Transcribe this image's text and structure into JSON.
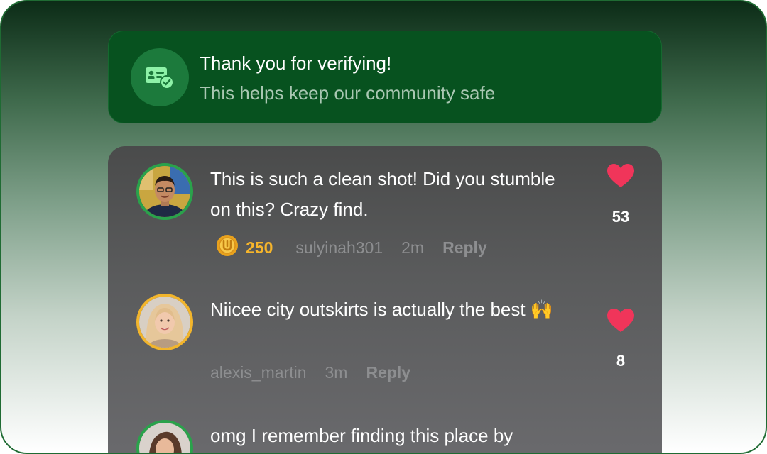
{
  "verification": {
    "title": "Thank you for verifying!",
    "subtitle": "This helps keep our community safe",
    "icon": "verified-id-icon"
  },
  "colors": {
    "accent_green": "#07521f",
    "heart_red": "#f0355a",
    "coin_gold": "#f6b52b"
  },
  "comments": [
    {
      "text": "This is such a clean shot! Did you stumble on this? Crazy find.",
      "coins": "250",
      "username": "sulyinah301",
      "time": "2m",
      "reply": "Reply",
      "likes": "53",
      "avatar_ring": "green"
    },
    {
      "text": "Niicee city outskirts is actually the best 🙌",
      "username": "alexis_martin",
      "time": "3m",
      "reply": "Reply",
      "likes": "8",
      "avatar_ring": "gold"
    },
    {
      "text": "omg I remember finding this place by",
      "avatar_ring": "green"
    }
  ]
}
